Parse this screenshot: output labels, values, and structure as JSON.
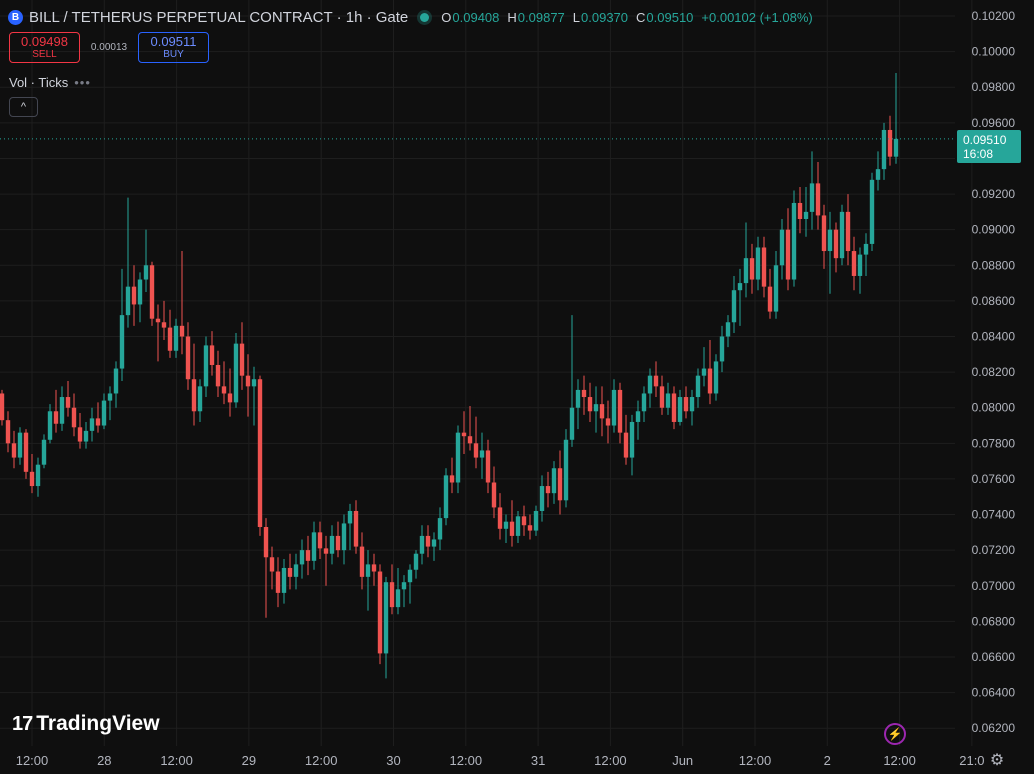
{
  "header": {
    "logo_letter": "B",
    "title": "BILL / TETHERUS PERPETUAL CONTRACT · 1h · Gate",
    "ohlc": [
      {
        "key": "O",
        "value": "0.09408"
      },
      {
        "key": "H",
        "value": "0.09877"
      },
      {
        "key": "L",
        "value": "0.09370"
      },
      {
        "key": "C",
        "value": "0.09510"
      }
    ],
    "change": "+0.00102 (+1.08%)"
  },
  "trade": {
    "sell_price": "0.09498",
    "sell_label": "SELL",
    "spread": "0.00013",
    "buy_price": "0.09511",
    "buy_label": "BUY"
  },
  "indicator": {
    "label": "Vol · Ticks",
    "menu": "•••"
  },
  "collapse_icon": "^",
  "price_tag": {
    "price": "0.09510",
    "countdown": "16:08"
  },
  "branding": {
    "logo_mark": "17",
    "logo_text": "TradingView"
  },
  "colors": {
    "up": "#26a69a",
    "down": "#ef5350",
    "background": "#0f0f0f",
    "grid": "#1e1e1e"
  },
  "icons": {
    "bolt": "⚡",
    "gear": "⚙"
  },
  "chart_data": {
    "type": "candlestick",
    "ylim": [
      0.061,
      0.1029
    ],
    "y_ticks": [
      "0.10200",
      "0.10000",
      "0.09800",
      "0.09600",
      "0.09400",
      "0.09200",
      "0.09000",
      "0.08800",
      "0.08600",
      "0.08400",
      "0.08200",
      "0.08000",
      "0.07800",
      "0.07600",
      "0.07400",
      "0.07200",
      "0.07000",
      "0.06800",
      "0.06600",
      "0.06400",
      "0.06200"
    ],
    "x_ticks": [
      "12:00",
      "28",
      "12:00",
      "29",
      "12:00",
      "30",
      "12:00",
      "31",
      "12:00",
      "Jun",
      "12:00",
      "2",
      "12:00",
      "21:0"
    ],
    "last_price": 0.0951,
    "candles": [
      [
        0.0808,
        0.081,
        0.079,
        0.0793
      ],
      [
        0.0793,
        0.0798,
        0.0775,
        0.078
      ],
      [
        0.078,
        0.0787,
        0.0766,
        0.0772
      ],
      [
        0.0772,
        0.0789,
        0.0768,
        0.0786
      ],
      [
        0.0786,
        0.0788,
        0.076,
        0.0764
      ],
      [
        0.0764,
        0.0774,
        0.0752,
        0.0756
      ],
      [
        0.0756,
        0.0772,
        0.075,
        0.0768
      ],
      [
        0.0768,
        0.0785,
        0.0766,
        0.0782
      ],
      [
        0.0782,
        0.0802,
        0.078,
        0.0798
      ],
      [
        0.0798,
        0.081,
        0.0786,
        0.0791
      ],
      [
        0.0791,
        0.0812,
        0.0787,
        0.0806
      ],
      [
        0.0806,
        0.0815,
        0.0795,
        0.08
      ],
      [
        0.08,
        0.0808,
        0.0784,
        0.0789
      ],
      [
        0.0789,
        0.0797,
        0.0777,
        0.0781
      ],
      [
        0.0781,
        0.0792,
        0.0777,
        0.0787
      ],
      [
        0.0787,
        0.08,
        0.0781,
        0.0794
      ],
      [
        0.0794,
        0.0803,
        0.0786,
        0.079
      ],
      [
        0.079,
        0.0808,
        0.0788,
        0.0804
      ],
      [
        0.0804,
        0.0812,
        0.0793,
        0.0808
      ],
      [
        0.0808,
        0.0826,
        0.08,
        0.0822
      ],
      [
        0.0822,
        0.0878,
        0.0815,
        0.0852
      ],
      [
        0.0852,
        0.0918,
        0.0845,
        0.0868
      ],
      [
        0.0868,
        0.088,
        0.0846,
        0.0858
      ],
      [
        0.0858,
        0.0876,
        0.0848,
        0.0872
      ],
      [
        0.0872,
        0.09,
        0.0865,
        0.088
      ],
      [
        0.088,
        0.0882,
        0.0846,
        0.085
      ],
      [
        0.085,
        0.0858,
        0.0826,
        0.0848
      ],
      [
        0.0848,
        0.086,
        0.0838,
        0.0845
      ],
      [
        0.0845,
        0.0855,
        0.0828,
        0.0832
      ],
      [
        0.0832,
        0.085,
        0.0828,
        0.0846
      ],
      [
        0.0846,
        0.0888,
        0.083,
        0.084
      ],
      [
        0.084,
        0.0848,
        0.081,
        0.0816
      ],
      [
        0.0816,
        0.0836,
        0.079,
        0.0798
      ],
      [
        0.0798,
        0.0816,
        0.0792,
        0.0812
      ],
      [
        0.0812,
        0.084,
        0.0806,
        0.0835
      ],
      [
        0.0835,
        0.0843,
        0.0818,
        0.0824
      ],
      [
        0.0824,
        0.0832,
        0.0806,
        0.0812
      ],
      [
        0.0812,
        0.0826,
        0.0802,
        0.0808
      ],
      [
        0.0808,
        0.0822,
        0.0795,
        0.0803
      ],
      [
        0.0803,
        0.0842,
        0.08,
        0.0836
      ],
      [
        0.0836,
        0.0848,
        0.081,
        0.0818
      ],
      [
        0.0818,
        0.083,
        0.0795,
        0.0812
      ],
      [
        0.0812,
        0.0823,
        0.079,
        0.0816
      ],
      [
        0.0816,
        0.0818,
        0.0728,
        0.0733
      ],
      [
        0.0733,
        0.0738,
        0.0682,
        0.0716
      ],
      [
        0.0716,
        0.0722,
        0.0698,
        0.0708
      ],
      [
        0.0708,
        0.0716,
        0.0688,
        0.0696
      ],
      [
        0.0696,
        0.0715,
        0.069,
        0.071
      ],
      [
        0.071,
        0.0718,
        0.0698,
        0.0705
      ],
      [
        0.0705,
        0.0718,
        0.0698,
        0.0712
      ],
      [
        0.0712,
        0.0726,
        0.0704,
        0.072
      ],
      [
        0.072,
        0.0728,
        0.0706,
        0.0714
      ],
      [
        0.0714,
        0.0736,
        0.0709,
        0.073
      ],
      [
        0.073,
        0.0736,
        0.0715,
        0.0721
      ],
      [
        0.0721,
        0.0728,
        0.07,
        0.0718
      ],
      [
        0.0718,
        0.0734,
        0.0712,
        0.0728
      ],
      [
        0.0728,
        0.0736,
        0.0716,
        0.072
      ],
      [
        0.072,
        0.074,
        0.0712,
        0.0735
      ],
      [
        0.0735,
        0.0746,
        0.072,
        0.0742
      ],
      [
        0.0742,
        0.0748,
        0.0718,
        0.0722
      ],
      [
        0.0722,
        0.073,
        0.0698,
        0.0705
      ],
      [
        0.0705,
        0.072,
        0.0686,
        0.0712
      ],
      [
        0.0712,
        0.0718,
        0.07,
        0.0708
      ],
      [
        0.0708,
        0.0712,
        0.0656,
        0.0662
      ],
      [
        0.0662,
        0.0705,
        0.0648,
        0.0702
      ],
      [
        0.0702,
        0.0712,
        0.0684,
        0.0688
      ],
      [
        0.0688,
        0.071,
        0.0684,
        0.0698
      ],
      [
        0.0698,
        0.0706,
        0.0688,
        0.0702
      ],
      [
        0.0702,
        0.0712,
        0.069,
        0.0709
      ],
      [
        0.0709,
        0.072,
        0.0704,
        0.0718
      ],
      [
        0.0718,
        0.0734,
        0.0712,
        0.0728
      ],
      [
        0.0728,
        0.0734,
        0.0716,
        0.0722
      ],
      [
        0.0722,
        0.073,
        0.0714,
        0.0726
      ],
      [
        0.0726,
        0.0744,
        0.072,
        0.0738
      ],
      [
        0.0738,
        0.0766,
        0.0734,
        0.0762
      ],
      [
        0.0762,
        0.0772,
        0.0752,
        0.0758
      ],
      [
        0.0758,
        0.079,
        0.0752,
        0.0786
      ],
      [
        0.0786,
        0.0798,
        0.0774,
        0.0784
      ],
      [
        0.0784,
        0.0801,
        0.0776,
        0.078
      ],
      [
        0.078,
        0.0795,
        0.0766,
        0.0772
      ],
      [
        0.0772,
        0.0786,
        0.076,
        0.0776
      ],
      [
        0.0776,
        0.0782,
        0.0752,
        0.0758
      ],
      [
        0.0758,
        0.0767,
        0.0738,
        0.0744
      ],
      [
        0.0744,
        0.0752,
        0.0726,
        0.0732
      ],
      [
        0.0732,
        0.074,
        0.0724,
        0.0736
      ],
      [
        0.0736,
        0.0748,
        0.0722,
        0.0728
      ],
      [
        0.0728,
        0.0742,
        0.0724,
        0.0739
      ],
      [
        0.0739,
        0.0745,
        0.0728,
        0.0734
      ],
      [
        0.0734,
        0.074,
        0.0726,
        0.0731
      ],
      [
        0.0731,
        0.0745,
        0.0728,
        0.0742
      ],
      [
        0.0742,
        0.0762,
        0.0736,
        0.0756
      ],
      [
        0.0756,
        0.0764,
        0.0744,
        0.0752
      ],
      [
        0.0752,
        0.077,
        0.0746,
        0.0766
      ],
      [
        0.0766,
        0.0776,
        0.074,
        0.0748
      ],
      [
        0.0748,
        0.0788,
        0.0744,
        0.0782
      ],
      [
        0.0782,
        0.0852,
        0.0778,
        0.08
      ],
      [
        0.08,
        0.0816,
        0.0788,
        0.081
      ],
      [
        0.081,
        0.0818,
        0.0796,
        0.0806
      ],
      [
        0.0806,
        0.0814,
        0.0792,
        0.0798
      ],
      [
        0.0798,
        0.0812,
        0.0786,
        0.0802
      ],
      [
        0.0802,
        0.0812,
        0.0784,
        0.0794
      ],
      [
        0.0794,
        0.0804,
        0.078,
        0.079
      ],
      [
        0.079,
        0.0816,
        0.0786,
        0.081
      ],
      [
        0.081,
        0.0814,
        0.078,
        0.0786
      ],
      [
        0.0786,
        0.0796,
        0.0768,
        0.0772
      ],
      [
        0.0772,
        0.0796,
        0.0762,
        0.0792
      ],
      [
        0.0792,
        0.0804,
        0.0782,
        0.0798
      ],
      [
        0.0798,
        0.0812,
        0.0792,
        0.0808
      ],
      [
        0.0808,
        0.0822,
        0.08,
        0.0818
      ],
      [
        0.0818,
        0.0826,
        0.0806,
        0.0812
      ],
      [
        0.0812,
        0.0818,
        0.0796,
        0.08
      ],
      [
        0.08,
        0.0814,
        0.0796,
        0.0808
      ],
      [
        0.0808,
        0.0812,
        0.0788,
        0.0792
      ],
      [
        0.0792,
        0.081,
        0.079,
        0.0806
      ],
      [
        0.0806,
        0.0812,
        0.0794,
        0.0798
      ],
      [
        0.0798,
        0.081,
        0.079,
        0.0806
      ],
      [
        0.0806,
        0.0822,
        0.08,
        0.0818
      ],
      [
        0.0818,
        0.0834,
        0.0812,
        0.0822
      ],
      [
        0.0822,
        0.0838,
        0.0802,
        0.0808
      ],
      [
        0.0808,
        0.083,
        0.0804,
        0.0826
      ],
      [
        0.0826,
        0.0846,
        0.082,
        0.084
      ],
      [
        0.084,
        0.0852,
        0.0834,
        0.0848
      ],
      [
        0.0848,
        0.0874,
        0.0842,
        0.0866
      ],
      [
        0.0866,
        0.0878,
        0.0846,
        0.087
      ],
      [
        0.087,
        0.0904,
        0.0862,
        0.0884
      ],
      [
        0.0884,
        0.0892,
        0.0864,
        0.0872
      ],
      [
        0.0872,
        0.0896,
        0.0866,
        0.089
      ],
      [
        0.089,
        0.0896,
        0.0862,
        0.0868
      ],
      [
        0.0868,
        0.0878,
        0.085,
        0.0854
      ],
      [
        0.0854,
        0.0888,
        0.085,
        0.088
      ],
      [
        0.088,
        0.0906,
        0.0872,
        0.09
      ],
      [
        0.09,
        0.0912,
        0.0866,
        0.0872
      ],
      [
        0.0872,
        0.0922,
        0.0868,
        0.0915
      ],
      [
        0.0915,
        0.0924,
        0.0898,
        0.0906
      ],
      [
        0.0906,
        0.0924,
        0.0896,
        0.091
      ],
      [
        0.091,
        0.0944,
        0.09,
        0.0926
      ],
      [
        0.0926,
        0.0938,
        0.09,
        0.0908
      ],
      [
        0.0908,
        0.0914,
        0.0878,
        0.0888
      ],
      [
        0.0888,
        0.091,
        0.0864,
        0.09
      ],
      [
        0.09,
        0.0904,
        0.0876,
        0.0884
      ],
      [
        0.0884,
        0.0914,
        0.088,
        0.091
      ],
      [
        0.091,
        0.092,
        0.088,
        0.0888
      ],
      [
        0.0888,
        0.0896,
        0.0866,
        0.0874
      ],
      [
        0.0874,
        0.089,
        0.0864,
        0.0886
      ],
      [
        0.0886,
        0.0898,
        0.0874,
        0.0892
      ],
      [
        0.0892,
        0.0932,
        0.0888,
        0.0928
      ],
      [
        0.0928,
        0.0944,
        0.0922,
        0.0934
      ],
      [
        0.0934,
        0.096,
        0.0928,
        0.0956
      ],
      [
        0.0956,
        0.0964,
        0.0936,
        0.0941
      ],
      [
        0.0941,
        0.0988,
        0.0937,
        0.0951
      ]
    ]
  }
}
